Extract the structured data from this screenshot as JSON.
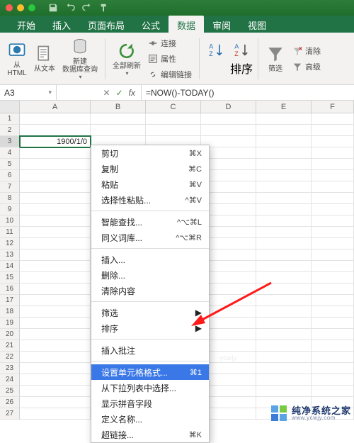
{
  "titlebar": {
    "qat": [
      "save-icon",
      "undo-icon",
      "redo-icon",
      "brush-icon"
    ]
  },
  "tabs": [
    "开始",
    "插入",
    "页面布局",
    "公式",
    "数据",
    "审阅",
    "视图"
  ],
  "active_tab_index": 4,
  "ribbon": {
    "from_html": "从\nHTML",
    "from_text": "从文本",
    "new_db_query": "新建\n数据库查询",
    "refresh_all": "全部刷新",
    "connections": "连接",
    "properties": "属性",
    "edit_links": "编辑链接",
    "sort_asc": "A→Z",
    "sort_desc": "Z→A",
    "sort": "排序",
    "filter": "筛选",
    "clear": "清除",
    "advanced": "高级"
  },
  "namebox": "A3",
  "formula": "=NOW()-TODAY()",
  "columns": [
    "A",
    "B",
    "C",
    "D",
    "E",
    "F"
  ],
  "row_count": 27,
  "cells": {
    "A3": "1900/1/0"
  },
  "selected_cell": "A3",
  "context_menu": {
    "groups": [
      [
        {
          "label": "剪切",
          "shortcut": "⌘X"
        },
        {
          "label": "复制",
          "shortcut": "⌘C"
        },
        {
          "label": "粘贴",
          "shortcut": "⌘V"
        },
        {
          "label": "选择性粘贴...",
          "shortcut": "^⌘V"
        }
      ],
      [
        {
          "label": "智能查找...",
          "shortcut": "^⌥⌘L"
        },
        {
          "label": "同义词库...",
          "shortcut": "^⌥⌘R"
        }
      ],
      [
        {
          "label": "插入...",
          "shortcut": ""
        },
        {
          "label": "删除...",
          "shortcut": ""
        },
        {
          "label": "清除内容",
          "shortcut": ""
        }
      ],
      [
        {
          "label": "筛选",
          "submenu": true
        },
        {
          "label": "排序",
          "submenu": true
        }
      ],
      [
        {
          "label": "插入批注",
          "shortcut": ""
        }
      ],
      [
        {
          "label": "设置单元格格式...",
          "shortcut": "⌘1",
          "highlight": true
        },
        {
          "label": "从下拉列表中选择...",
          "shortcut": ""
        },
        {
          "label": "显示拼音字段",
          "shortcut": ""
        },
        {
          "label": "定义名称...",
          "shortcut": ""
        },
        {
          "label": "超链接...",
          "shortcut": "⌘K"
        }
      ]
    ]
  },
  "watermark": {
    "main": "纯净系统之家",
    "sub": "www.ycwjy.com"
  },
  "faint_mark": "ycwjy"
}
